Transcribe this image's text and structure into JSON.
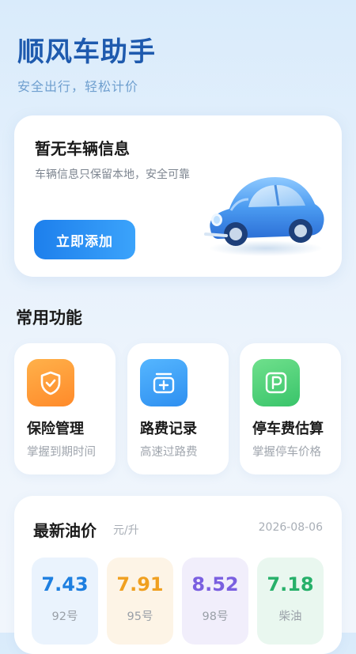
{
  "header": {
    "title": "顺风车助手",
    "subtitle": "安全出行，轻松计价"
  },
  "vehicle": {
    "title": "暂无车辆信息",
    "description": "车辆信息只保留本地，安全可靠",
    "add_button_label": "立即添加",
    "illustration": "blue-beetle-car"
  },
  "features": {
    "section_title": "常用功能",
    "items": [
      {
        "name": "保险管理",
        "desc": "掌握到期时间",
        "icon": "shield-check-icon",
        "color": "#ff9a36"
      },
      {
        "name": "路费记录",
        "desc": "高速过路费",
        "icon": "toll-box-icon",
        "color": "#3a9cf5"
      },
      {
        "name": "停车费估算",
        "desc": "掌握停车价格",
        "icon": "parking-icon",
        "color": "#45cc74"
      }
    ]
  },
  "fuel": {
    "title": "最新油价",
    "unit": "元/升",
    "date": "2026-08-06",
    "items": [
      {
        "price": "7.43",
        "label": "92号",
        "color": "#1e7fe0"
      },
      {
        "price": "7.91",
        "label": "95号",
        "color": "#f0a020"
      },
      {
        "price": "8.52",
        "label": "98号",
        "color": "#7a5fe0"
      },
      {
        "price": "7.18",
        "label": "柴油",
        "color": "#27b06a"
      }
    ]
  }
}
